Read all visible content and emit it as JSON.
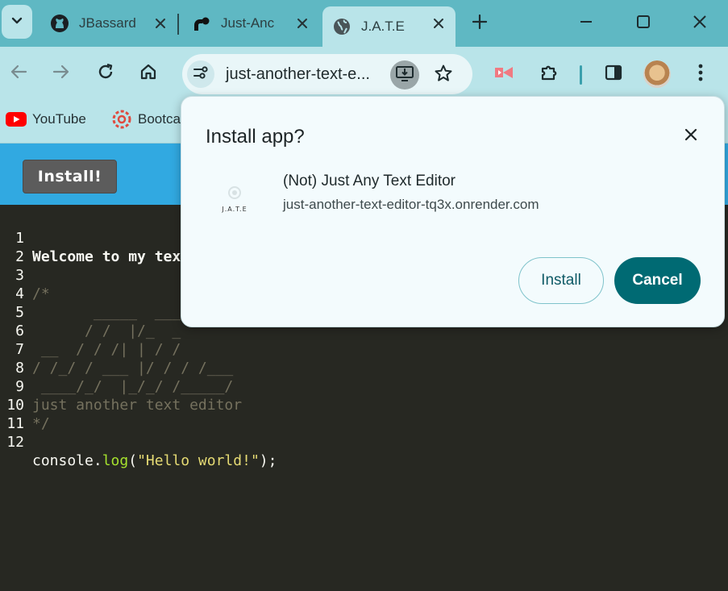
{
  "browser": {
    "tabs": [
      {
        "title": "JBassard",
        "icon": "github-icon"
      },
      {
        "title": "Just-Anc",
        "icon": "render-icon"
      },
      {
        "title": "J.A.T.E",
        "icon": "globe-icon",
        "active": true
      }
    ],
    "address_bar": {
      "url": "just-another-text-e..."
    },
    "bookmarks": [
      {
        "label": "YouTube",
        "icon": "youtube-icon"
      },
      {
        "label": "Bootca",
        "icon": "bootcamp-icon"
      }
    ]
  },
  "page": {
    "install_button": "Install!",
    "editor_lines": [
      {
        "num": "1",
        "text": "Welcome to my text",
        "style": "bold"
      },
      {
        "num": "2",
        "text": "",
        "style": "plain"
      },
      {
        "num": "3",
        "text": "/*",
        "style": "comment"
      },
      {
        "num": "4",
        "text": "       _____  ___",
        "style": "comment"
      },
      {
        "num": "5",
        "text": "      / /  |/_  _",
        "style": "comment"
      },
      {
        "num": "6",
        "text": " __  / / /| | / /",
        "style": "comment"
      },
      {
        "num": "7",
        "text": "/ /_/ / ___ |/ / / /___",
        "style": "comment"
      },
      {
        "num": "8",
        "text": " ____/_/  |_/_/ /_____/",
        "style": "comment"
      },
      {
        "num": "9",
        "text": "just another text editor",
        "style": "comment"
      },
      {
        "num": "10",
        "text": "*/",
        "style": "comment"
      },
      {
        "num": "11",
        "text": "",
        "style": "plain"
      },
      {
        "num": "12",
        "code": {
          "obj": "console",
          "dot": ".",
          "fn": "log",
          "open": "(",
          "str": "\"Hello world!\"",
          "close": ");"
        }
      }
    ]
  },
  "install_dialog": {
    "title": "Install app?",
    "app_name": "(Not) Just Any Text Editor",
    "app_origin": "just-another-text-editor-tq3x.onrender.com",
    "app_icon_text": "J.A.T.E",
    "install_label": "Install",
    "cancel_label": "Cancel"
  },
  "colors": {
    "tabstrip": "#5fb8c3",
    "toolbar": "#b9e4e9",
    "page_header": "#31a9e1",
    "editor_bg": "#272822",
    "dialog_primary": "#006a73"
  }
}
